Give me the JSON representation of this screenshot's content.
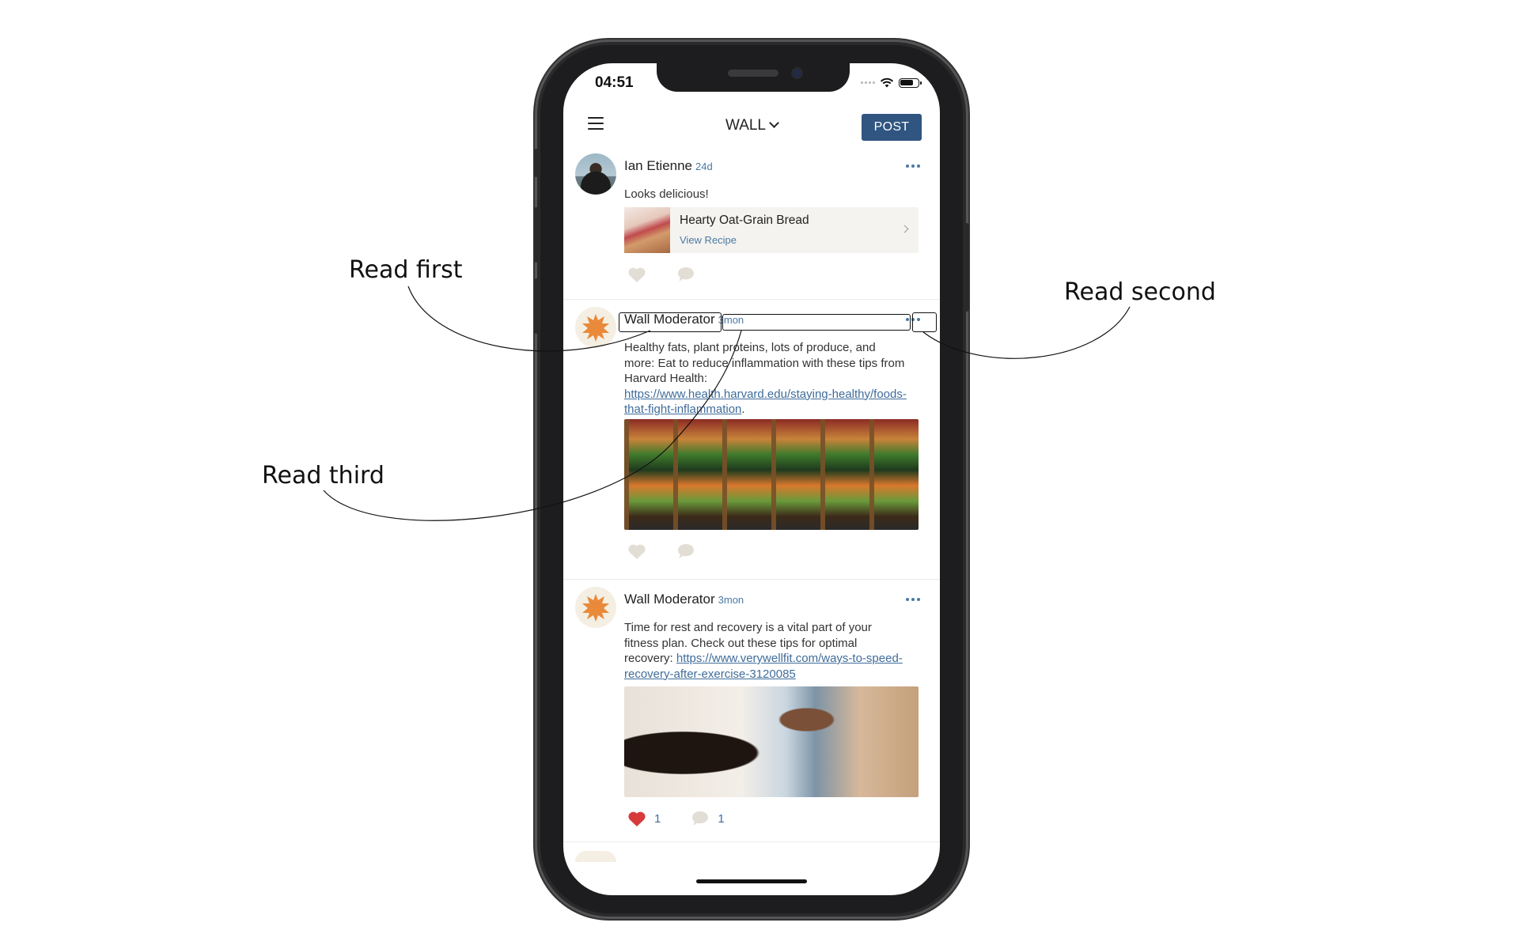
{
  "annotations": {
    "read_first": "Read first",
    "read_second": "Read second",
    "read_third": "Read third"
  },
  "status_bar": {
    "time": "04:51"
  },
  "header": {
    "title": "WALL",
    "post_button": "POST"
  },
  "posts": [
    {
      "author": "Ian Etienne",
      "time": "24d",
      "text": "Looks delicious!",
      "recipe": {
        "title": "Hearty Oat-Grain Bread",
        "link": "View Recipe"
      }
    },
    {
      "author": "Wall Moderator",
      "time": "3mon",
      "text_before": "Healthy fats, plant proteins, lots of produce, and more: Eat to reduce inflammation with these tips from Harvard Health: ",
      "link": "https://www.health.harvard.edu/staying-healthy/foods-that-fight-inflammation",
      "text_after": "."
    },
    {
      "author": "Wall Moderator",
      "time": "3mon",
      "text_before": "Time for rest and recovery is a vital part of your fitness plan. Check out these tips for optimal recovery: ",
      "link": "https://www.verywellfit.com/ways-to-speed-recovery-after-exercise-3120085",
      "likes": "1",
      "comments": "1"
    }
  ],
  "colors": {
    "accent": "#2f5580",
    "link": "#3f6c9a",
    "heart_active": "#d63a3a"
  },
  "icons": [
    "menu-icon",
    "chevron-down-icon",
    "more-icon",
    "heart-icon",
    "comment-icon",
    "chevron-right-icon",
    "wifi-icon",
    "battery-icon",
    "leaf-icon"
  ]
}
